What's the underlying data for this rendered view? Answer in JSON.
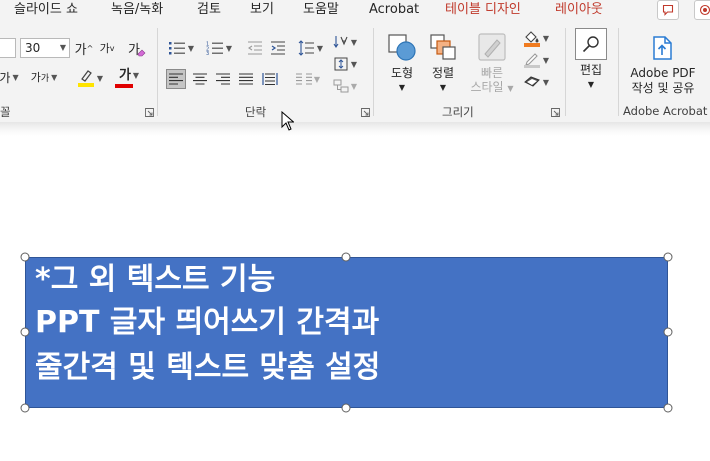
{
  "tabs": [
    {
      "label": "슬라이드 쇼",
      "contextual": false
    },
    {
      "label": "녹음/녹화",
      "contextual": false
    },
    {
      "label": "검토",
      "contextual": false
    },
    {
      "label": "보기",
      "contextual": false
    },
    {
      "label": "도움말",
      "contextual": false
    },
    {
      "label": "Acrobat",
      "contextual": false
    },
    {
      "label": "테이블 디자인",
      "contextual": true
    },
    {
      "label": "레이아웃",
      "contextual": true
    }
  ],
  "font": {
    "size_value": "30",
    "grow_label": "가",
    "shrink_label": "가",
    "clear_label": "가",
    "spacing_label": "가",
    "case_label": "가",
    "font_color_label": "가",
    "group_label_partial": "꼴",
    "highlight_color": "#ffe400",
    "font_color": "#e00000"
  },
  "paragraph": {
    "group_label": "단락"
  },
  "drawing": {
    "group_label": "그리기",
    "shapes_label": "도형",
    "arrange_label": "정렬",
    "quick_styles_label_1": "빠른",
    "quick_styles_label_2": "스타일",
    "fill_color": "#f07b1f"
  },
  "editing": {
    "label": "편집"
  },
  "acrobat": {
    "label_1": "Adobe PDF",
    "label_2": "작성 및 공유",
    "group_label": "Adobe Acrobat"
  },
  "slide": {
    "lines": [
      "*그 외 텍스트 기능",
      "PPT 글자 띄어쓰기 간격과",
      "줄간격 및 텍스트 맞춤 설정"
    ],
    "box_color": "#4472c4"
  }
}
